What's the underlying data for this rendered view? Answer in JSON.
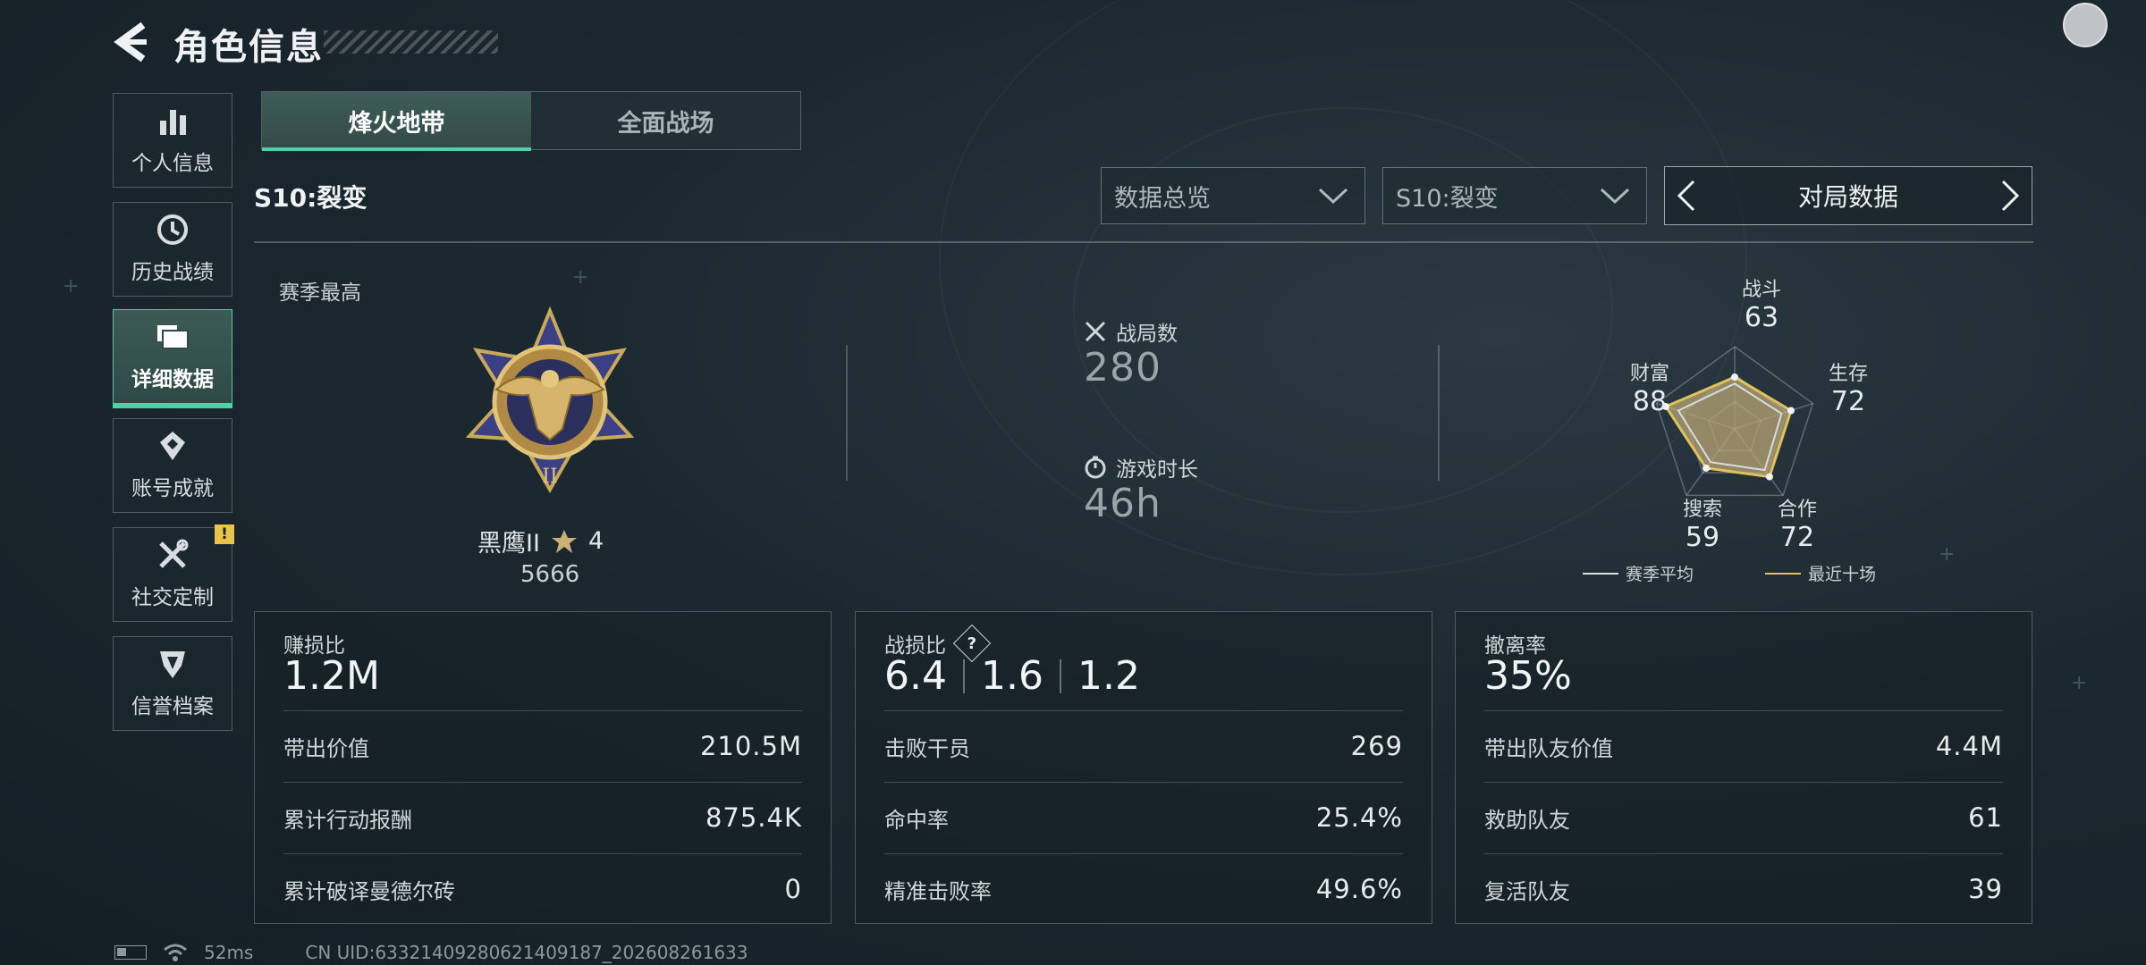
{
  "header": {
    "title": "角色信息"
  },
  "sidebar": {
    "items": [
      {
        "label": "个人信息",
        "icon": "bar-chart-icon",
        "active": false
      },
      {
        "label": "历史战绩",
        "icon": "history-icon",
        "active": false
      },
      {
        "label": "详细数据",
        "icon": "folder-icon",
        "active": true
      },
      {
        "label": "账号成就",
        "icon": "achievement-icon",
        "active": false
      },
      {
        "label": "社交定制",
        "icon": "tools-icon",
        "active": false,
        "badge": "!"
      },
      {
        "label": "信誉档案",
        "icon": "credit-icon",
        "active": false
      }
    ]
  },
  "tabs": [
    {
      "label": "烽火地带",
      "active": true
    },
    {
      "label": "全面战场",
      "active": false
    }
  ],
  "season_label": "S10:裂变",
  "filters": {
    "overview_dropdown": "数据总览",
    "season_dropdown": "S10:裂变",
    "match_switch": "对局数据"
  },
  "rank": {
    "section_label": "赛季最高",
    "name": "黑鹰II",
    "stars": "4",
    "score": "5666"
  },
  "summary": {
    "matches_label": "战局数",
    "matches_value": "280",
    "playtime_label": "游戏时长",
    "playtime_value": "46h"
  },
  "radar": {
    "axes": [
      {
        "name": "战斗",
        "value": "63"
      },
      {
        "name": "生存",
        "value": "72"
      },
      {
        "name": "合作",
        "value": "72"
      },
      {
        "name": "搜索",
        "value": "59"
      },
      {
        "name": "财富",
        "value": "88"
      }
    ],
    "season_avg": [
      0.55,
      0.6,
      0.62,
      0.5,
      0.72
    ],
    "recent_ten": [
      0.63,
      0.72,
      0.72,
      0.59,
      0.88
    ],
    "legend_avg": "赛季平均",
    "legend_recent": "最近十场",
    "colors": {
      "avg": "#d8dde0",
      "recent": "#e0c25a",
      "fill": "#b9a675"
    }
  },
  "panels": {
    "profit": {
      "title": "赚损比",
      "big": "1.2M",
      "rows": [
        {
          "label": "带出价值",
          "value": "210.5M"
        },
        {
          "label": "累计行动报酬",
          "value": "875.4K"
        },
        {
          "label": "累计破译曼德尔砖",
          "value": "0"
        }
      ]
    },
    "combat": {
      "title": "战损比",
      "help": "?",
      "big": [
        "6.4",
        "1.6",
        "1.2"
      ],
      "rows": [
        {
          "label": "击败干员",
          "value": "269"
        },
        {
          "label": "命中率",
          "value": "25.4%"
        },
        {
          "label": "精准击败率",
          "value": "49.6%"
        }
      ]
    },
    "extract": {
      "title": "撤离率",
      "big": "35%",
      "rows": [
        {
          "label": "带出队友价值",
          "value": "4.4M"
        },
        {
          "label": "救助队友",
          "value": "61"
        },
        {
          "label": "复活队友",
          "value": "39"
        }
      ]
    }
  },
  "status": {
    "ping": "52ms",
    "uid": "CN UID:633214092806214091​87_202608261633"
  },
  "accent": "#4fd1a6"
}
